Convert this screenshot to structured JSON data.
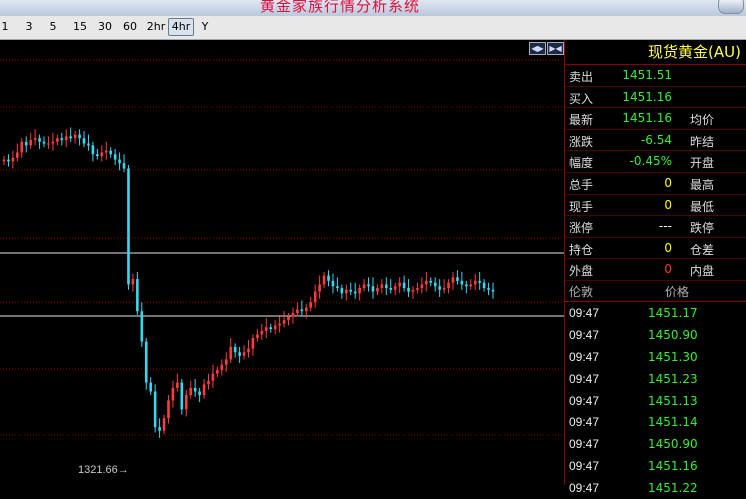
{
  "title": "黄金家族行情分析系统",
  "toolbar": {
    "periods": [
      {
        "label": "1",
        "active": false
      },
      {
        "label": "3",
        "active": false
      },
      {
        "label": "5",
        "active": false
      },
      {
        "label": "15",
        "active": false
      },
      {
        "label": "30",
        "active": false
      },
      {
        "label": "60",
        "active": false
      },
      {
        "label": "2hr",
        "active": false
      },
      {
        "label": "4hr",
        "active": true
      },
      {
        "label": "Y",
        "active": false
      }
    ]
  },
  "chart": {
    "low_label": "1321.66→",
    "nav_icons": [
      "scroll-left-icon",
      "scroll-right-icon"
    ],
    "colors": {
      "up": "#ff3c3c",
      "down": "#36d9f2",
      "grid": "#8b0000",
      "line": "#e8e8e8"
    }
  },
  "chart_data": {
    "type": "candlestick",
    "low_marker": 1321.66,
    "series": [
      {
        "values": [
          1390,
          1389,
          1391,
          1394,
          1400,
          1398,
          1401,
          1402,
          1400,
          1399,
          1399,
          1400,
          1402,
          1401,
          1403,
          1402,
          1404,
          1402,
          1399,
          1398,
          1393,
          1392,
          1394,
          1395,
          1393,
          1390,
          1388,
          1385,
          1320,
          1323,
          1305,
          1288,
          1265,
          1260,
          1240,
          1238,
          1245,
          1255,
          1262,
          1265,
          1250,
          1258,
          1262,
          1260,
          1258,
          1264,
          1266,
          1270,
          1272,
          1275,
          1278,
          1285,
          1282,
          1280,
          1282,
          1284,
          1290,
          1292,
          1294,
          1296,
          1295,
          1297,
          1298,
          1300,
          1302,
          1304,
          1306,
          1305,
          1307,
          1310,
          1316,
          1320,
          1325,
          1322,
          1319,
          1318,
          1315,
          1317,
          1316,
          1315,
          1318,
          1320,
          1319,
          1316,
          1318,
          1320,
          1318,
          1317,
          1319,
          1321,
          1318,
          1316,
          1317,
          1318,
          1320,
          1322,
          1321,
          1319,
          1317,
          1318,
          1321,
          1324,
          1322,
          1320,
          1319,
          1320,
          1322,
          1321,
          1318,
          1317,
          1316
        ]
      }
    ]
  },
  "quote_panel": {
    "name": "现货黄金(AU)",
    "rows": [
      {
        "label": "卖出",
        "value": "1451.51",
        "color": "#33ee33",
        "label2": ""
      },
      {
        "label": "买入",
        "value": "1451.16",
        "color": "#33ee33",
        "label2": ""
      },
      {
        "label": "最新",
        "value": "1451.16",
        "color": "#33ee33",
        "label2": "均价"
      },
      {
        "label": "涨跌",
        "value": "-6.54",
        "color": "#33ee33",
        "label2": "昨结"
      },
      {
        "label": "幅度",
        "value": "-0.45%",
        "color": "#33ee33",
        "label2": "开盘"
      },
      {
        "label": "总手",
        "value": "0",
        "color": "#ffff00",
        "label2": "最高"
      },
      {
        "label": "现手",
        "value": "0",
        "color": "#ffff00",
        "label2": "最低"
      },
      {
        "label": "涨停",
        "value": "---",
        "color": "#ffffff",
        "label2": "跌停"
      },
      {
        "label": "持仓",
        "value": "0",
        "color": "#ffff00",
        "label2": "仓差"
      },
      {
        "label": "外盘",
        "value": "0",
        "color": "#ff3333",
        "label2": "内盘"
      }
    ],
    "ticks_header": {
      "time": "伦敦",
      "price": "价格"
    },
    "ticks": [
      {
        "time": "09:47",
        "price": "1451.17"
      },
      {
        "time": "09:47",
        "price": "1450.90"
      },
      {
        "time": "09:47",
        "price": "1451.30"
      },
      {
        "time": "09:47",
        "price": "1451.23"
      },
      {
        "time": "09:47",
        "price": "1451.13"
      },
      {
        "time": "09:47",
        "price": "1451.14"
      },
      {
        "time": "09:47",
        "price": "1450.90"
      },
      {
        "time": "09:47",
        "price": "1451.16"
      },
      {
        "time": "09:47",
        "price": "1451.22"
      }
    ]
  }
}
